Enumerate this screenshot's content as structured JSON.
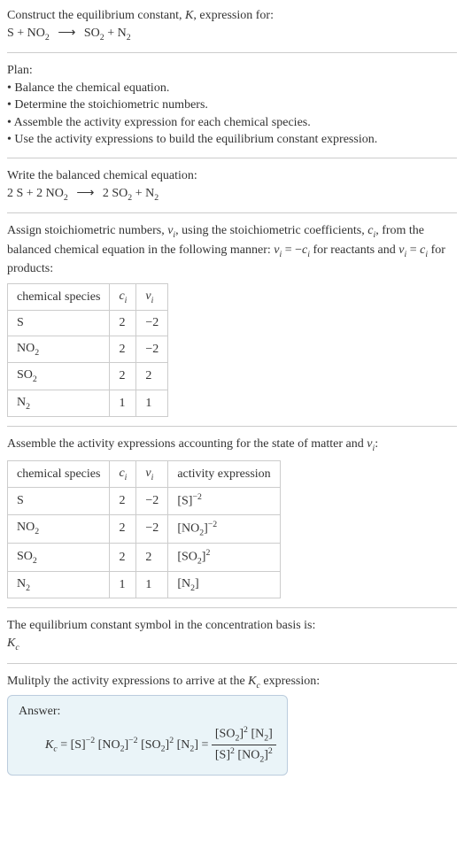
{
  "intro": {
    "line1_a": "Construct the equilibrium constant, ",
    "line1_K": "K",
    "line1_b": ", expression for:",
    "eq_lhs": "S + NO",
    "eq_sub1": "2",
    "arrow": "⟶",
    "eq_rhs_a": " SO",
    "eq_sub2": "2",
    "eq_rhs_b": " + N",
    "eq_sub3": "2"
  },
  "plan": {
    "title": "Plan:",
    "b1": "• Balance the chemical equation.",
    "b2": "• Determine the stoichiometric numbers.",
    "b3": "• Assemble the activity expression for each chemical species.",
    "b4": "• Use the activity expressions to build the equilibrium constant expression."
  },
  "balanced": {
    "label": "Write the balanced chemical equation:",
    "lhs_a": "2 S + 2 NO",
    "lhs_sub": "2",
    "arrow": "⟶",
    "rhs_a": " 2 SO",
    "rhs_sub1": "2",
    "rhs_b": " + N",
    "rhs_sub2": "2"
  },
  "assign": {
    "t1": "Assign stoichiometric numbers, ",
    "nu": "ν",
    "sub_i": "i",
    "t2": ", using the stoichiometric coefficients, ",
    "c": "c",
    "t3": ", from the balanced chemical equation in the following manner: ",
    "eq1_a": "ν",
    "eq1_b": " = −",
    "eq1_c": "c",
    "t4": " for reactants and ",
    "eq2_a": "ν",
    "eq2_b": " = ",
    "eq2_c": "c",
    "t5": " for products:"
  },
  "table1": {
    "h1": "chemical species",
    "h2_a": "c",
    "h2_b": "i",
    "h3_a": "ν",
    "h3_b": "i",
    "r1": {
      "sp_a": "S",
      "sp_sub": "",
      "c": "2",
      "v": "−2"
    },
    "r2": {
      "sp_a": "NO",
      "sp_sub": "2",
      "c": "2",
      "v": "−2"
    },
    "r3": {
      "sp_a": "SO",
      "sp_sub": "2",
      "c": "2",
      "v": "2"
    },
    "r4": {
      "sp_a": "N",
      "sp_sub": "2",
      "c": "1",
      "v": "1"
    }
  },
  "assemble": {
    "t1": "Assemble the activity expressions accounting for the state of matter and ",
    "nu": "ν",
    "sub_i": "i",
    "t2": ":"
  },
  "table2": {
    "h1": "chemical species",
    "h2_a": "c",
    "h2_b": "i",
    "h3_a": "ν",
    "h3_b": "i",
    "h4": "activity expression",
    "r1": {
      "sp_a": "S",
      "sp_sub": "",
      "c": "2",
      "v": "−2",
      "ex_a": "[S]",
      "ex_pow": "−2"
    },
    "r2": {
      "sp_a": "NO",
      "sp_sub": "2",
      "c": "2",
      "v": "−2",
      "ex_a": "[NO",
      "ex_sub": "2",
      "ex_b": "]",
      "ex_pow": "−2"
    },
    "r3": {
      "sp_a": "SO",
      "sp_sub": "2",
      "c": "2",
      "v": "2",
      "ex_a": "[SO",
      "ex_sub": "2",
      "ex_b": "]",
      "ex_pow": "2"
    },
    "r4": {
      "sp_a": "N",
      "sp_sub": "2",
      "c": "1",
      "v": "1",
      "ex_a": "[N",
      "ex_sub": "2",
      "ex_b": "]"
    }
  },
  "ksymbol": {
    "line": "The equilibrium constant symbol in the concentration basis is:",
    "K": "K",
    "sub": "c"
  },
  "mult": {
    "t1": "Mulitply the activity expressions to arrive at the ",
    "K": "K",
    "sub": "c",
    "t2": " expression:"
  },
  "answer": {
    "label": "Answer:",
    "Kc_K": "K",
    "Kc_sub": "c",
    "eq": " = ",
    "t_s": "[S]",
    "p_m2": "−2",
    "sp": " ",
    "t_no_a": "[NO",
    "t_no_sub": "2",
    "t_no_b": "]",
    "t_so_a": "[SO",
    "t_so_sub": "2",
    "t_so_b": "]",
    "p_2": "2",
    "t_n_a": "[N",
    "t_n_sub": "2",
    "t_n_b": "]",
    "eq2": " = "
  }
}
